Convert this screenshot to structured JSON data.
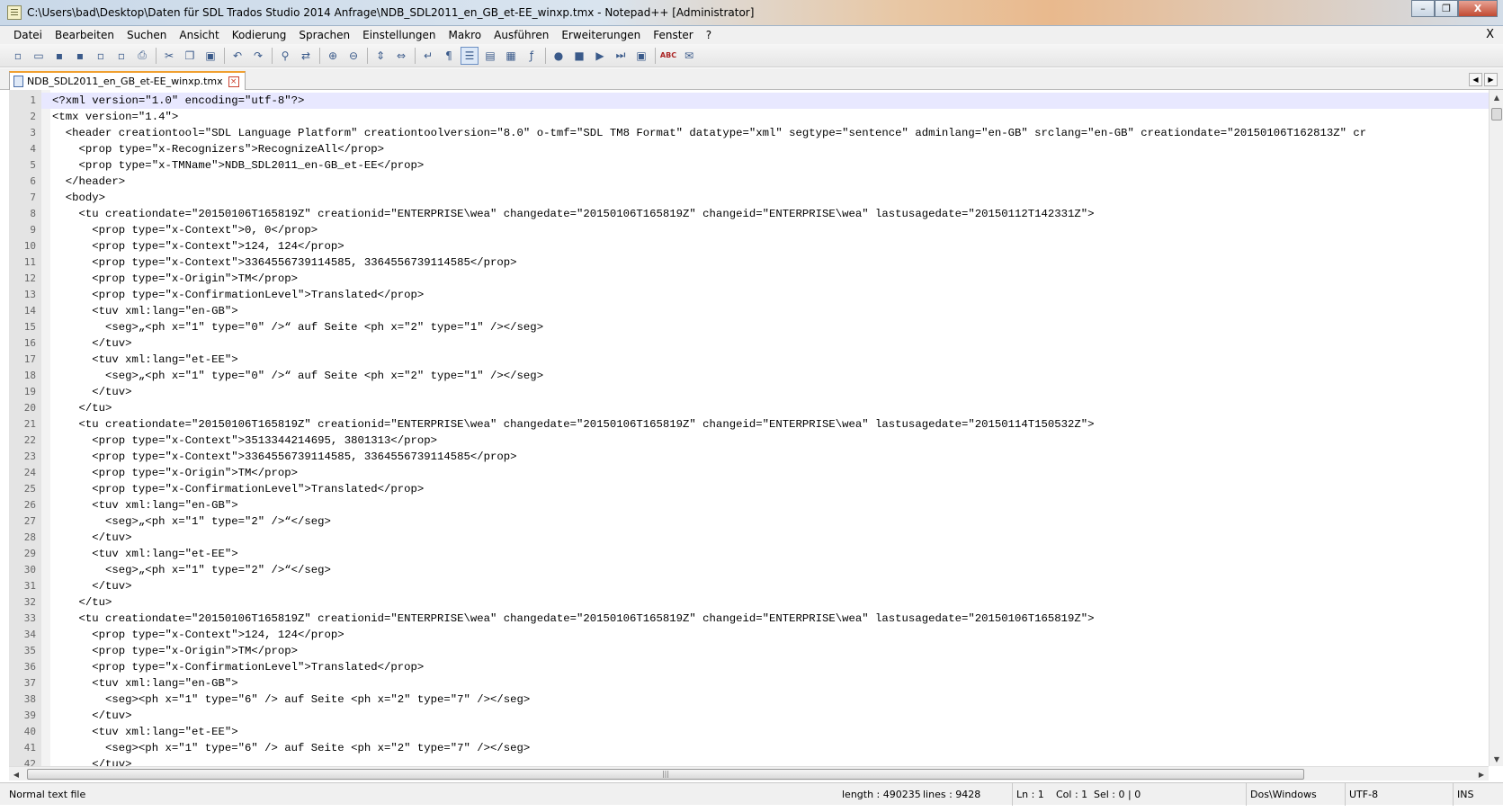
{
  "window": {
    "title": "C:\\Users\\bad\\Desktop\\Daten für SDL Trados Studio 2014 Anfrage\\NDB_SDL2011_en_GB_et-EE_winxp.tmx - Notepad++ [Administrator]",
    "controls": [
      "–",
      "❐",
      "X"
    ]
  },
  "menu": {
    "items": [
      "Datei",
      "Bearbeiten",
      "Suchen",
      "Ansicht",
      "Kodierung",
      "Sprachen",
      "Einstellungen",
      "Makro",
      "Ausführen",
      "Erweiterungen",
      "Fenster",
      "?"
    ],
    "close": "X"
  },
  "toolbar": {
    "buttons": [
      {
        "name": "new-file-icon",
        "glyph": "▫"
      },
      {
        "name": "open-file-icon",
        "glyph": "▭"
      },
      {
        "name": "save-icon",
        "glyph": "▪"
      },
      {
        "name": "save-all-icon",
        "glyph": "▪"
      },
      {
        "name": "close-file-icon",
        "glyph": "▫"
      },
      {
        "name": "close-all-icon",
        "glyph": "▫"
      },
      {
        "name": "print-icon",
        "glyph": "⎙"
      },
      {
        "sep": true
      },
      {
        "name": "cut-icon",
        "glyph": "✂"
      },
      {
        "name": "copy-icon",
        "glyph": "❐"
      },
      {
        "name": "paste-icon",
        "glyph": "▣"
      },
      {
        "sep": true
      },
      {
        "name": "undo-icon",
        "glyph": "↶"
      },
      {
        "name": "redo-icon",
        "glyph": "↷"
      },
      {
        "sep": true
      },
      {
        "name": "find-icon",
        "glyph": "⚲"
      },
      {
        "name": "replace-icon",
        "glyph": "⇄"
      },
      {
        "sep": true
      },
      {
        "name": "zoom-in-icon",
        "glyph": "⊕"
      },
      {
        "name": "zoom-out-icon",
        "glyph": "⊖"
      },
      {
        "sep": true
      },
      {
        "name": "sync-vertical-icon",
        "glyph": "⇕"
      },
      {
        "name": "sync-horizontal-icon",
        "glyph": "⇔"
      },
      {
        "sep": true
      },
      {
        "name": "word-wrap-icon",
        "glyph": "↵"
      },
      {
        "name": "show-all-chars-icon",
        "glyph": "¶"
      },
      {
        "name": "indent-guide-icon",
        "glyph": "☰",
        "active": true
      },
      {
        "name": "language-icon",
        "glyph": "▤"
      },
      {
        "name": "document-map-icon",
        "glyph": "▦"
      },
      {
        "name": "function-list-icon",
        "glyph": "ƒ"
      },
      {
        "sep": true
      },
      {
        "name": "record-macro-icon",
        "glyph": "●"
      },
      {
        "name": "stop-macro-icon",
        "glyph": "■"
      },
      {
        "name": "play-macro-icon",
        "glyph": "▶"
      },
      {
        "name": "run-macro-multiple-icon",
        "glyph": "⏭"
      },
      {
        "name": "save-macro-icon",
        "glyph": "▣"
      },
      {
        "sep": true
      },
      {
        "name": "spell-check-icon",
        "glyph": "ABC"
      },
      {
        "name": "spell-settings-icon",
        "glyph": "✉"
      }
    ]
  },
  "tab": {
    "label": "NDB_SDL2011_en_GB_et-EE_winxp.tmx",
    "close": "×",
    "arrows": [
      "◀",
      "▶"
    ]
  },
  "editor": {
    "current_line": 1,
    "lines": [
      "<?xml version=\"1.0\" encoding=\"utf-8\"?>",
      "<tmx version=\"1.4\">",
      "  <header creationtool=\"SDL Language Platform\" creationtoolversion=\"8.0\" o-tmf=\"SDL TM8 Format\" datatype=\"xml\" segtype=\"sentence\" adminlang=\"en-GB\" srclang=\"en-GB\" creationdate=\"20150106T162813Z\" cr",
      "    <prop type=\"x-Recognizers\">RecognizeAll</prop>",
      "    <prop type=\"x-TMName\">NDB_SDL2011_en-GB_et-EE</prop>",
      "  </header>",
      "  <body>",
      "    <tu creationdate=\"20150106T165819Z\" creationid=\"ENTERPRISE\\wea\" changedate=\"20150106T165819Z\" changeid=\"ENTERPRISE\\wea\" lastusagedate=\"20150112T142331Z\">",
      "      <prop type=\"x-Context\">0, 0</prop>",
      "      <prop type=\"x-Context\">124, 124</prop>",
      "      <prop type=\"x-Context\">3364556739114585, 3364556739114585</prop>",
      "      <prop type=\"x-Origin\">TM</prop>",
      "      <prop type=\"x-ConfirmationLevel\">Translated</prop>",
      "      <tuv xml:lang=\"en-GB\">",
      "        <seg>„<ph x=\"1\" type=\"0\" />“ auf Seite <ph x=\"2\" type=\"1\" /></seg>",
      "      </tuv>",
      "      <tuv xml:lang=\"et-EE\">",
      "        <seg>„<ph x=\"1\" type=\"0\" />“ auf Seite <ph x=\"2\" type=\"1\" /></seg>",
      "      </tuv>",
      "    </tu>",
      "    <tu creationdate=\"20150106T165819Z\" creationid=\"ENTERPRISE\\wea\" changedate=\"20150106T165819Z\" changeid=\"ENTERPRISE\\wea\" lastusagedate=\"20150114T150532Z\">",
      "      <prop type=\"x-Context\">3513344214695, 3801313</prop>",
      "      <prop type=\"x-Context\">3364556739114585, 3364556739114585</prop>",
      "      <prop type=\"x-Origin\">TM</prop>",
      "      <prop type=\"x-ConfirmationLevel\">Translated</prop>",
      "      <tuv xml:lang=\"en-GB\">",
      "        <seg>„<ph x=\"1\" type=\"2\" />“</seg>",
      "      </tuv>",
      "      <tuv xml:lang=\"et-EE\">",
      "        <seg>„<ph x=\"1\" type=\"2\" />“</seg>",
      "      </tuv>",
      "    </tu>",
      "    <tu creationdate=\"20150106T165819Z\" creationid=\"ENTERPRISE\\wea\" changedate=\"20150106T165819Z\" changeid=\"ENTERPRISE\\wea\" lastusagedate=\"20150106T165819Z\">",
      "      <prop type=\"x-Context\">124, 124</prop>",
      "      <prop type=\"x-Origin\">TM</prop>",
      "      <prop type=\"x-ConfirmationLevel\">Translated</prop>",
      "      <tuv xml:lang=\"en-GB\">",
      "        <seg><ph x=\"1\" type=\"6\" /> auf Seite <ph x=\"2\" type=\"7\" /></seg>",
      "      </tuv>",
      "      <tuv xml:lang=\"et-EE\">",
      "        <seg><ph x=\"1\" type=\"6\" /> auf Seite <ph x=\"2\" type=\"7\" /></seg>",
      "      </tuv>"
    ]
  },
  "scrollbars": {
    "up": "▲",
    "down": "▼",
    "left": "◀",
    "right": "▶",
    "grip": "|||"
  },
  "status": {
    "file_type": "Normal text file",
    "length": "length : 490235",
    "lines": "lines : 9428",
    "ln": "Ln : 1",
    "col": "Col : 1",
    "sel": "Sel : 0 | 0",
    "eol": "Dos\\Windows",
    "encoding": "UTF-8",
    "mode": "INS"
  }
}
